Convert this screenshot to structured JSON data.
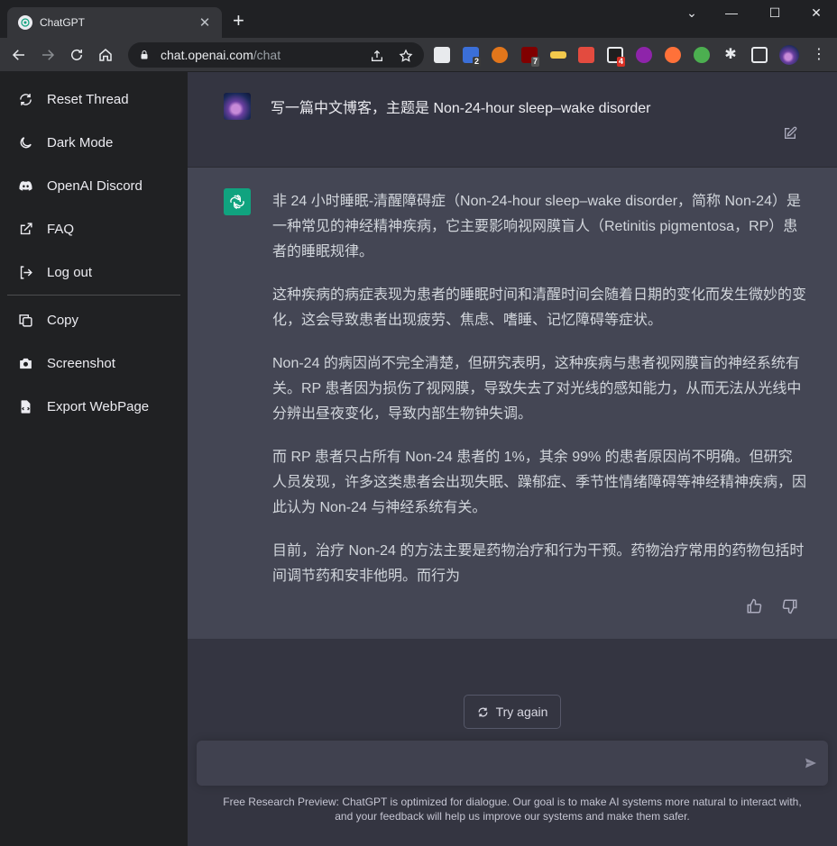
{
  "browser": {
    "tab_title": "ChatGPT",
    "url_host": "chat.openai.com",
    "url_path": "/chat",
    "ext_badges": [
      "2",
      "7",
      "4"
    ]
  },
  "sidebar": {
    "items": [
      {
        "label": "Reset Thread",
        "icon": "refresh-icon"
      },
      {
        "label": "Dark Mode",
        "icon": "moon-icon"
      },
      {
        "label": "OpenAI Discord",
        "icon": "discord-icon"
      },
      {
        "label": "FAQ",
        "icon": "external-link-icon"
      },
      {
        "label": "Log out",
        "icon": "logout-icon"
      },
      {
        "label": "Copy",
        "icon": "copy-icon"
      },
      {
        "label": "Screenshot",
        "icon": "camera-icon"
      },
      {
        "label": "Export WebPage",
        "icon": "file-export-icon"
      }
    ]
  },
  "conversation": {
    "user_message": "写一篇中文博客，主题是 Non-24-hour sleep–wake disorder",
    "assistant_paragraphs": [
      "非 24 小时睡眠-清醒障碍症（Non-24-hour sleep–wake disorder，简称 Non-24）是一种常见的神经精神疾病，它主要影响视网膜盲人（Retinitis pigmentosa，RP）患者的睡眠规律。",
      "这种疾病的病症表现为患者的睡眠时间和清醒时间会随着日期的变化而发生微妙的变化，这会导致患者出现疲劳、焦虑、嗜睡、记忆障碍等症状。",
      "Non-24 的病因尚不完全清楚，但研究表明，这种疾病与患者视网膜盲的神经系统有关。RP 患者因为损伤了视网膜，导致失去了对光线的感知能力，从而无法从光线中分辨出昼夜变化，导致内部生物钟失调。",
      "而 RP 患者只占所有 Non-24 患者的 1%，其余 99% 的患者原因尚不明确。但研究人员发现，许多这类患者会出现失眠、躁郁症、季节性情绪障碍等神经精神疾病，因此认为 Non-24 与神经系统有关。",
      "目前，治疗 Non-24 的方法主要是药物治疗和行为干预。药物治疗常用的药物包括时间调节药和安非他明。而行为"
    ]
  },
  "actions": {
    "try_again_label": "Try again"
  },
  "composer": {
    "value": "",
    "placeholder": ""
  },
  "footer": {
    "line1": "Free Research Preview: ChatGPT is optimized for dialogue. Our goal is to make AI systems more natural to interact with,",
    "line2": "and your feedback will help us improve our systems and make them safer."
  },
  "colors": {
    "sidebar_bg": "#202123",
    "main_bg": "#343541",
    "assistant_bg": "#444654",
    "brand_green": "#10a37f"
  }
}
